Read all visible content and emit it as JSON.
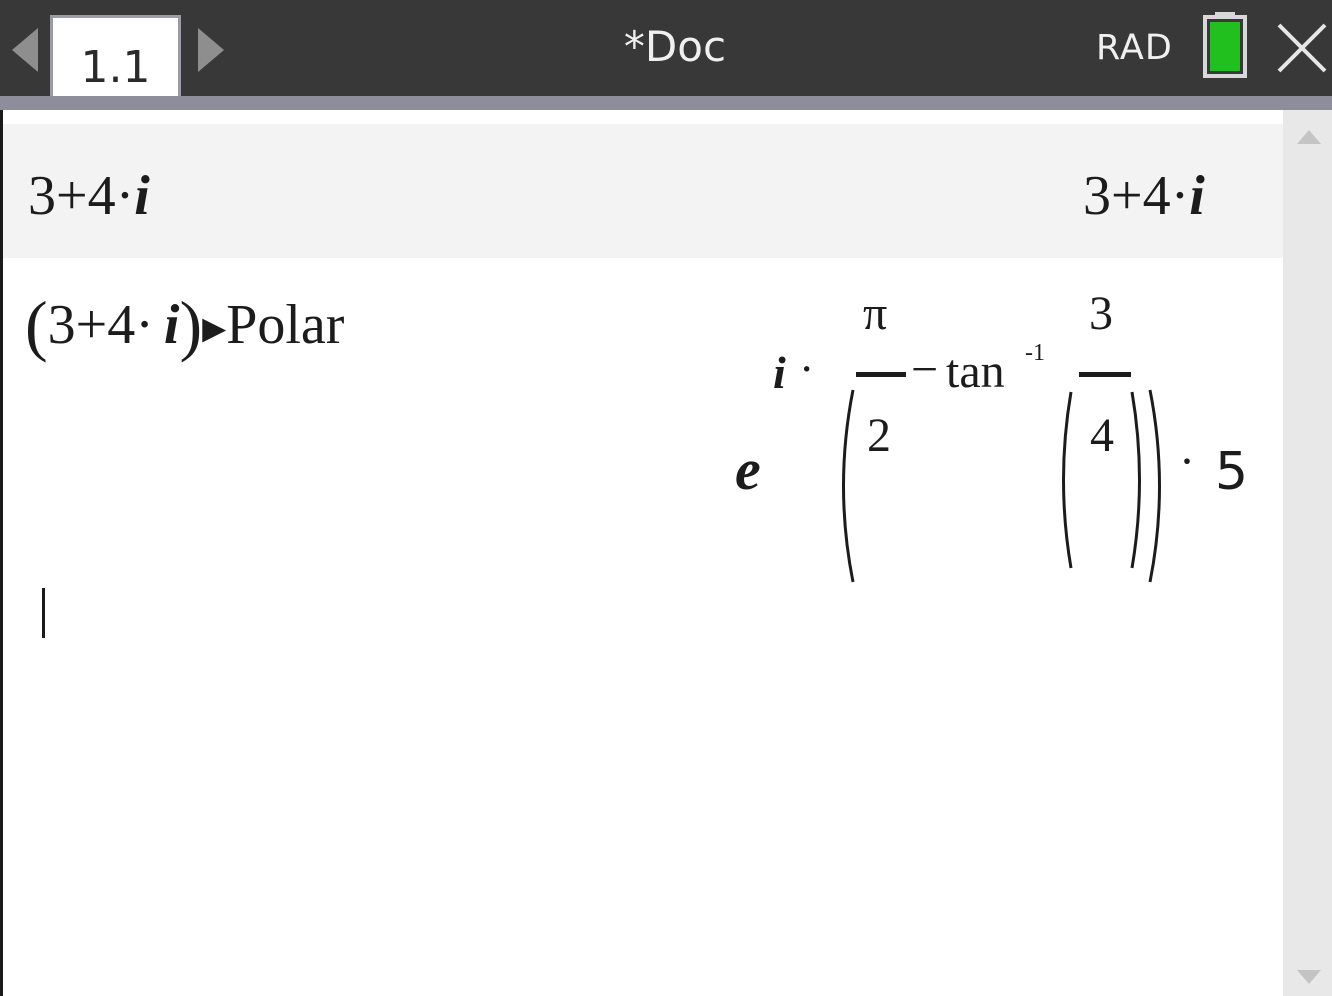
{
  "titlebar": {
    "tab_label": "1.1",
    "document_title": "*Doc",
    "angle_mode": "RAD",
    "icons": [
      "arrow-left-icon",
      "arrow-right-icon",
      "battery-icon",
      "close-icon"
    ],
    "battery_color": "#22c01e"
  },
  "calculator": {
    "entries": [
      {
        "input": {
          "a": "3+4·",
          "b": "i"
        },
        "output": {
          "a": "3+4·",
          "b": "i"
        }
      },
      {
        "input": {
          "lp": "(",
          "a": "3+4·",
          "b": "i",
          "rp": ")",
          "arrow": "▸",
          "cmd": "Polar"
        },
        "output": {
          "base": "e",
          "exp_i": "i",
          "exp_dot": "·",
          "pi": "π",
          "two": "2",
          "minus": "−",
          "tan": "tan",
          "inv": "-1",
          "three": "3",
          "four": "4",
          "times": "·",
          "five": "5"
        }
      }
    ]
  },
  "colors": {
    "title_bar": "#383838",
    "under_bar": "#8d8d9c",
    "entry_highlight": "#f3f3f3",
    "scrollbar": "#e8e8e8"
  }
}
